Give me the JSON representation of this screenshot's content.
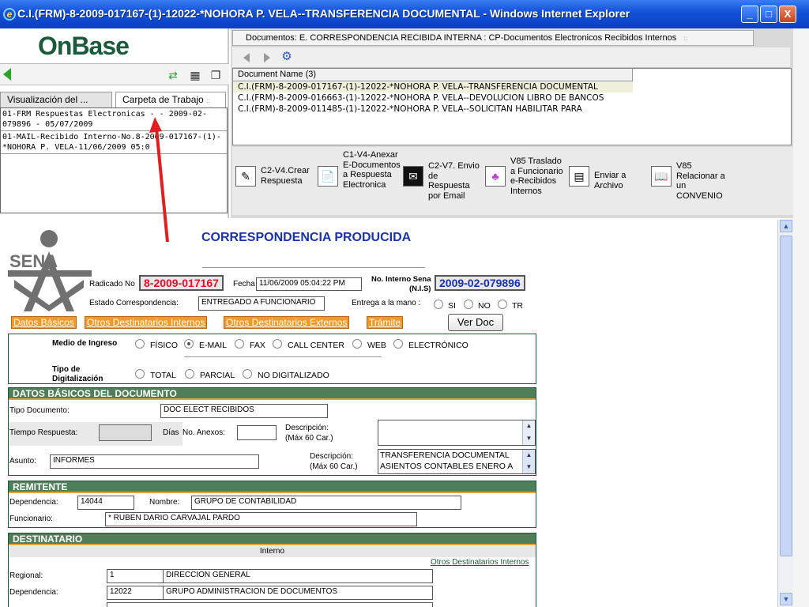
{
  "window": {
    "title": "C.I.(FRM)-8-2009-017167-(1)-12022-*NOHORA P. VELA--TRANSFERENCIA DOCUMENTAL - Windows Internet Explorer",
    "min_glyph": "_",
    "max_glyph": "□",
    "close_glyph": "X"
  },
  "left": {
    "logo": "OnBase",
    "tabs": [
      "Visualización del ...",
      "Carpeta de Trabajo"
    ],
    "tab_grip": "::",
    "items": [
      "01-FRM Respuestas Electronicas - - 2009-02-079896 - 05/07/2009",
      "01-MAIL-Recibido Interno-No.8-2009-017167-(1)-*NOHORA P. VELA-11/06/2009 05:0"
    ]
  },
  "docs": {
    "tab_label": "Documentos: E. CORRESPONDENCIA RECIBIDA INTERNA : CP-Documentos Electronicos Recibidos Internos",
    "tab_grip": "::",
    "column_header": "Document Name (3)",
    "rows": [
      "C.I.(FRM)-8-2009-017167-(1)-12022-*NOHORA P. VELA--TRANSFERENCIA DOCUMENTAL",
      "C.I.(FRM)-8-2009-016663-(1)-12022-*NOHORA P. VELA--DEVOLUCION LIBRO DE BANCOS",
      "C.I.(FRM)-8-2009-011485-(1)-12022-*NOHORA P. VELA--SOLICITAN HABILITAR PARA"
    ],
    "actions": [
      {
        "label": "C2-V4.Crear Respuesta",
        "icon": "pencil-icon"
      },
      {
        "label": "C1-V4-Anexar E-Documentos a Respuesta Electronica",
        "icon": "attach-icon"
      },
      {
        "label": "C2-V7. Envio de Respuesta por Email",
        "icon": "email-icon"
      },
      {
        "label": "V85 Traslado a Funcionario e-Recibidos Internos",
        "icon": "transfer-icon"
      },
      {
        "label": "Enviar a Archivo",
        "icon": "archive-icon"
      },
      {
        "label": "V85 Relacionar a un CONVENIO",
        "icon": "book-icon"
      }
    ]
  },
  "form": {
    "logo_text": "SENA",
    "title": "CORRESPONDENCIA PRODUCIDA",
    "radicado_label": "Radicado No",
    "radicado_value": "8-2009-017167",
    "fecha_label": "Fecha",
    "fecha_value": "11/06/2009 05:04:22 PM",
    "interno_label_1": "No. Interno Sena",
    "interno_label_2": "(N.I.S)",
    "interno_value": "2009-02-079896",
    "estado_label": "Estado Correspondencia:",
    "estado_value": "ENTREGADO A FUNCIONARIO",
    "entrega_label": "Entrega a la mano :",
    "entrega_options": [
      "SI",
      "NO",
      "TR"
    ],
    "tabs": [
      "Datos Básicos",
      "Otros Destinatarios Internos",
      "Otros Destinatarios Externos",
      "Trámite"
    ],
    "ver_doc": "Ver Doc",
    "medio_label": "Medio de Ingreso",
    "medio_options": [
      "FÍSICO",
      "E-MAIL",
      "FAX",
      "CALL CENTER",
      "WEB",
      "ELECTRÓNICO"
    ],
    "medio_selected": "E-MAIL",
    "tipo_dig_label_1": "Tipo de",
    "tipo_dig_label_2": "Digitalización",
    "tipo_dig_options": [
      "TOTAL",
      "PARCIAL",
      "NO DIGITALIZADO"
    ],
    "datos_hdr": "DATOS BÁSICOS DEL DOCUMENTO",
    "tipo_doc_label": "Tipo Documento:",
    "tipo_doc_value": "DOC ELECT RECIBIDOS",
    "tiempo_label": "Tiempo Respuesta:",
    "dias_label": "Días",
    "anexos_label": "No. Anexos:",
    "descripcion_label_1": "Descripción:",
    "descripcion_label_2": "(Máx 60 Car.)",
    "asunto_label": "Asunto:",
    "asunto_value": "INFORMES",
    "descripcion2_value_1": "TRANSFERENCIA DOCUMENTAL",
    "descripcion2_value_2": "ASIENTOS CONTABLES ENERO A",
    "remitente_hdr": "REMITENTE",
    "dependencia_label": "Dependencia:",
    "dependencia_value": "14044",
    "nombre_label": "Nombre:",
    "nombre_value": "GRUPO DE CONTABILIDAD",
    "funcionario_label": "Funcionario:",
    "funcionario_value": "* RUBEN DARIO CARVAJAL PARDO",
    "destinatario_hdr": "DESTINATARIO",
    "interno_band": "Interno",
    "otros_link": "Otros Destinatarios Internos",
    "regional_label": "Regional:",
    "regional_code": "1",
    "regional_name": "DIRECCION GENERAL",
    "dest_dep_label": "Dependencia:",
    "dest_dep_code": "12022",
    "dest_dep_name": "GRUPO ADMINISTRACION DE DOCUMENTOS"
  },
  "colors": {
    "title_blue": "#1a33a8",
    "radicado_red": "#e0102a",
    "section_green": "#4e7f58",
    "tab_orange": "#f39a2a",
    "annotation_arrow": "#e02020"
  }
}
